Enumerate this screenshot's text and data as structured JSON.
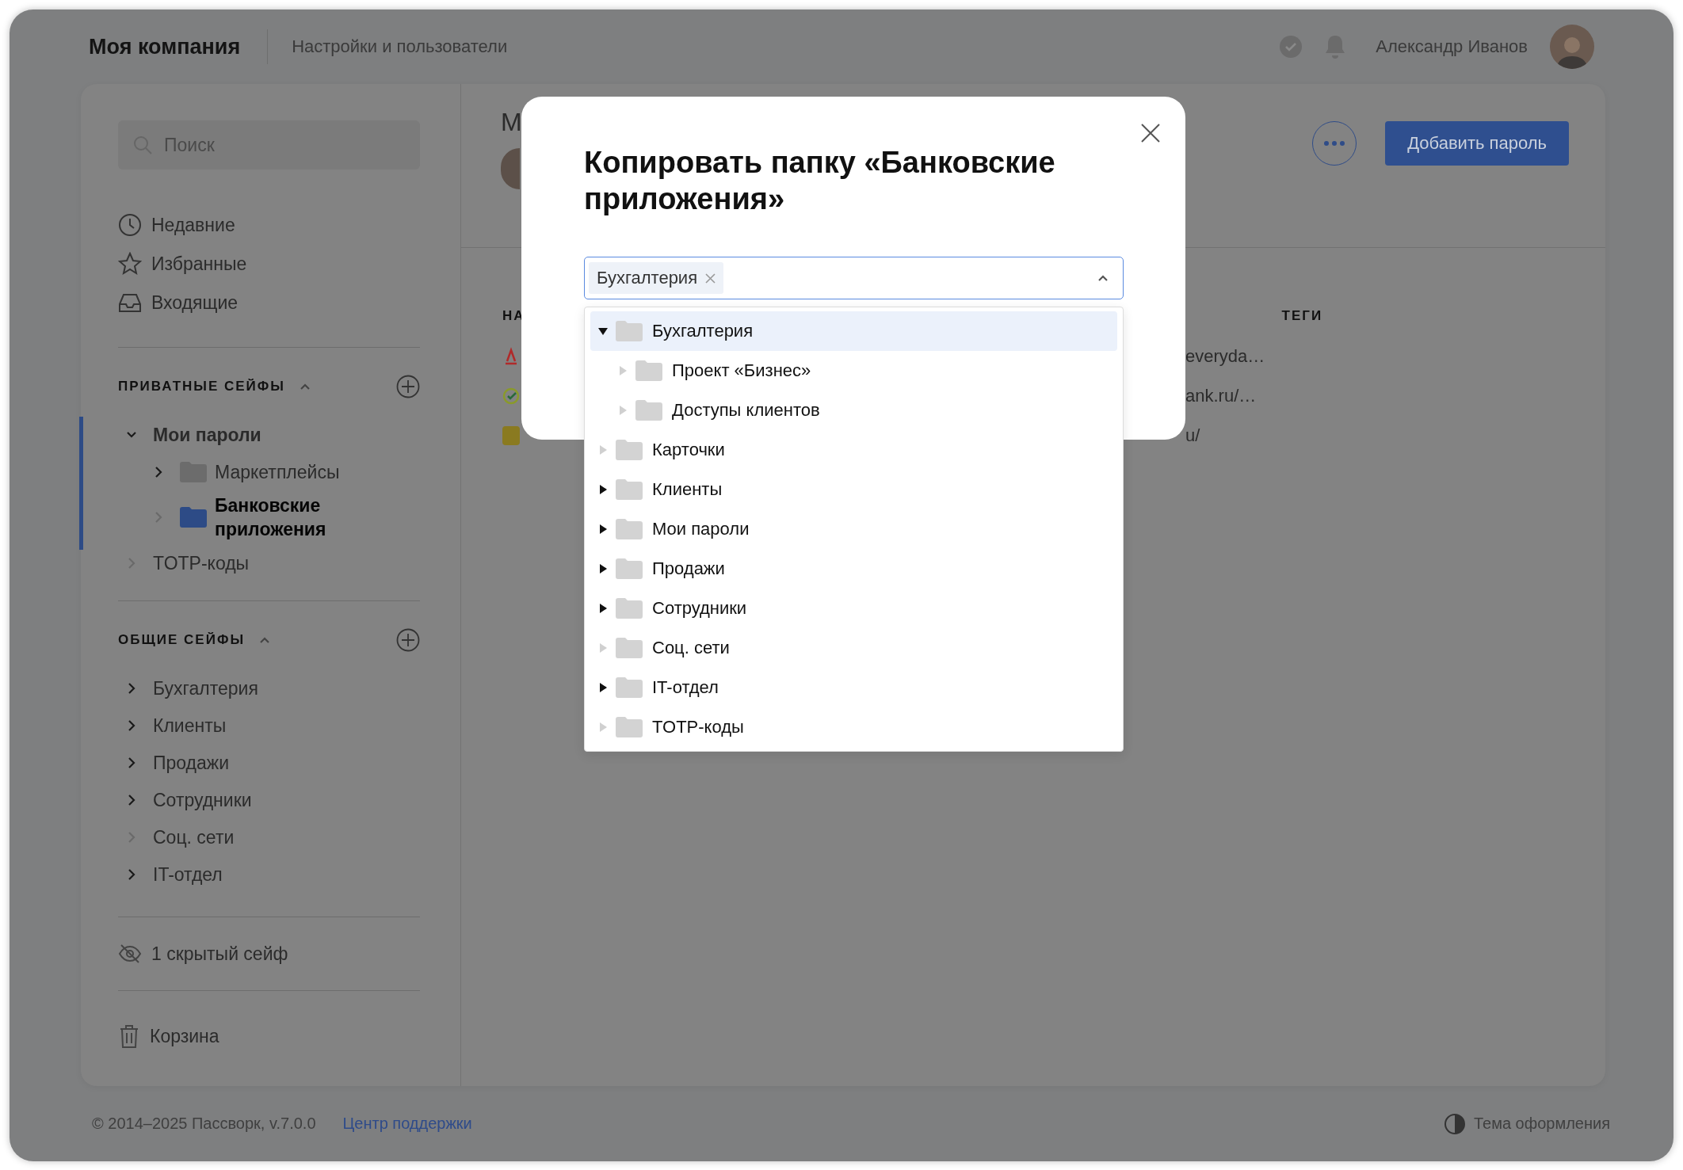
{
  "header": {
    "company": "Моя компания",
    "section": "Настройки и пользователи",
    "user": "Александр Иванов"
  },
  "sidebar": {
    "search": {
      "placeholder": "Поиск"
    },
    "nav": [
      "Недавние",
      "Избранные",
      "Входящие"
    ],
    "private_vaults": {
      "title": "ПРИВАТНЫЕ СЕЙФЫ",
      "expanded": true,
      "items": [
        {
          "label": "Мои пароли",
          "expanded": true,
          "expandable": true,
          "selected": false,
          "children": [
            {
              "label": "Маркетплейсы",
              "expanded": false,
              "expandable": true,
              "selected": false
            },
            {
              "label": "Банковские приложения",
              "expanded": false,
              "expandable": false,
              "selected": true
            }
          ]
        },
        {
          "label": "TOTP-коды",
          "expanded": false,
          "expandable": false,
          "selected": false
        }
      ]
    },
    "shared_vaults": {
      "title": "ОБЩИЕ СЕЙФЫ",
      "expanded": true,
      "items": [
        {
          "label": "Бухгалтерия",
          "expanded": false,
          "expandable": true,
          "selected": false
        },
        {
          "label": "Клиенты",
          "expanded": false,
          "expandable": true,
          "selected": false
        },
        {
          "label": "Продажи",
          "expanded": false,
          "expandable": true,
          "selected": false
        },
        {
          "label": "Сотрудники",
          "expanded": false,
          "expandable": true,
          "selected": false
        },
        {
          "label": "Соц. сети",
          "expanded": false,
          "expandable": false,
          "selected": false
        },
        {
          "label": "IT-отдел",
          "expanded": false,
          "expandable": true,
          "selected": false
        }
      ]
    },
    "hidden_vaults": "1 скрытый сейф",
    "trash": "Корзина"
  },
  "content": {
    "title": "М",
    "add_button": "Добавить пароль",
    "columns": [
      "НА",
      "ТЕГИ"
    ],
    "rows": [
      {
        "column_2": "everyda…"
      },
      {
        "column_2": "ank.ru/…"
      },
      {
        "column_2": "u/"
      }
    ]
  },
  "dialog": {
    "title": "Копировать папку «Банковские приложения»",
    "selected_tags": [
      "Бухгалтерия"
    ],
    "dropdown_open": true,
    "tree": [
      {
        "label": "Бухгалтерия",
        "expandable": true,
        "expanded": true,
        "selected": true,
        "children": [
          {
            "label": "Проект «Бизнес»",
            "expandable": false,
            "expanded": false,
            "selected": false
          },
          {
            "label": "Доступы клиентов",
            "expandable": false,
            "expanded": false,
            "selected": false
          }
        ]
      },
      {
        "label": "Карточки",
        "expandable": false,
        "expanded": false,
        "selected": false
      },
      {
        "label": "Клиенты",
        "expandable": true,
        "expanded": false,
        "selected": false
      },
      {
        "label": "Мои пароли",
        "expandable": true,
        "expanded": false,
        "selected": false
      },
      {
        "label": "Продажи",
        "expandable": true,
        "expanded": false,
        "selected": false
      },
      {
        "label": "Сотрудники",
        "expandable": true,
        "expanded": false,
        "selected": false
      },
      {
        "label": "Соц. сети",
        "expandable": false,
        "expanded": false,
        "selected": false
      },
      {
        "label": "IT-отдел",
        "expandable": true,
        "expanded": false,
        "selected": false
      },
      {
        "label": "TOTP-коды",
        "expandable": false,
        "expanded": false,
        "selected": false
      }
    ]
  },
  "footer": {
    "copyright": "© 2014–2025 Пассворк, v.7.0.0",
    "support_link": "Центр поддержки",
    "theme": "Тема оформления"
  }
}
